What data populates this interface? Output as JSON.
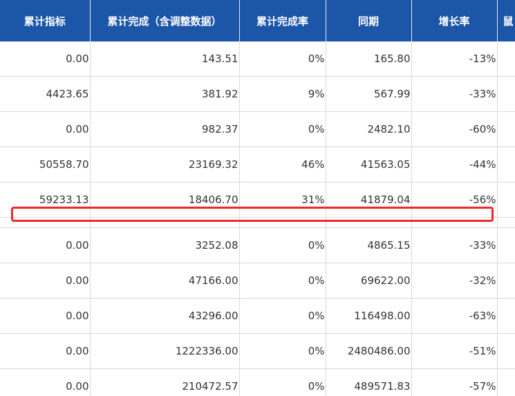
{
  "table": {
    "headers": [
      "累计指标",
      "累计完成（含调整数据）",
      "累计完成率",
      "同期",
      "增长率",
      "鼠"
    ],
    "rows": [
      [
        "0.00",
        "143.51",
        "0%",
        "165.80",
        "-13%"
      ],
      [
        "4423.65",
        "381.92",
        "9%",
        "567.99",
        "-33%"
      ],
      [
        "0.00",
        "982.37",
        "0%",
        "2482.10",
        "-60%"
      ],
      [
        "50558.70",
        "23169.32",
        "46%",
        "41563.05",
        "-44%"
      ],
      [
        "59233.13",
        "18406.70",
        "31%",
        "41879.04",
        "-56%"
      ],
      [
        "",
        "",
        "",
        "",
        ""
      ],
      [
        "0.00",
        "3252.08",
        "0%",
        "4865.15",
        "-33%"
      ],
      [
        "0.00",
        "47166.00",
        "0%",
        "69622.00",
        "-32%"
      ],
      [
        "0.00",
        "43296.00",
        "0%",
        "116498.00",
        "-63%"
      ],
      [
        "0.00",
        "1222336.00",
        "0%",
        "2480486.00",
        "-51%"
      ],
      [
        "0.00",
        "210472.57",
        "0%",
        "489571.83",
        "-57%"
      ]
    ]
  },
  "colors": {
    "header_bg": "#1c56a8",
    "header_text": "#ffffff",
    "grid_line": "#d9d9d9",
    "cell_text": "#333333",
    "highlight": "#f0262c"
  }
}
